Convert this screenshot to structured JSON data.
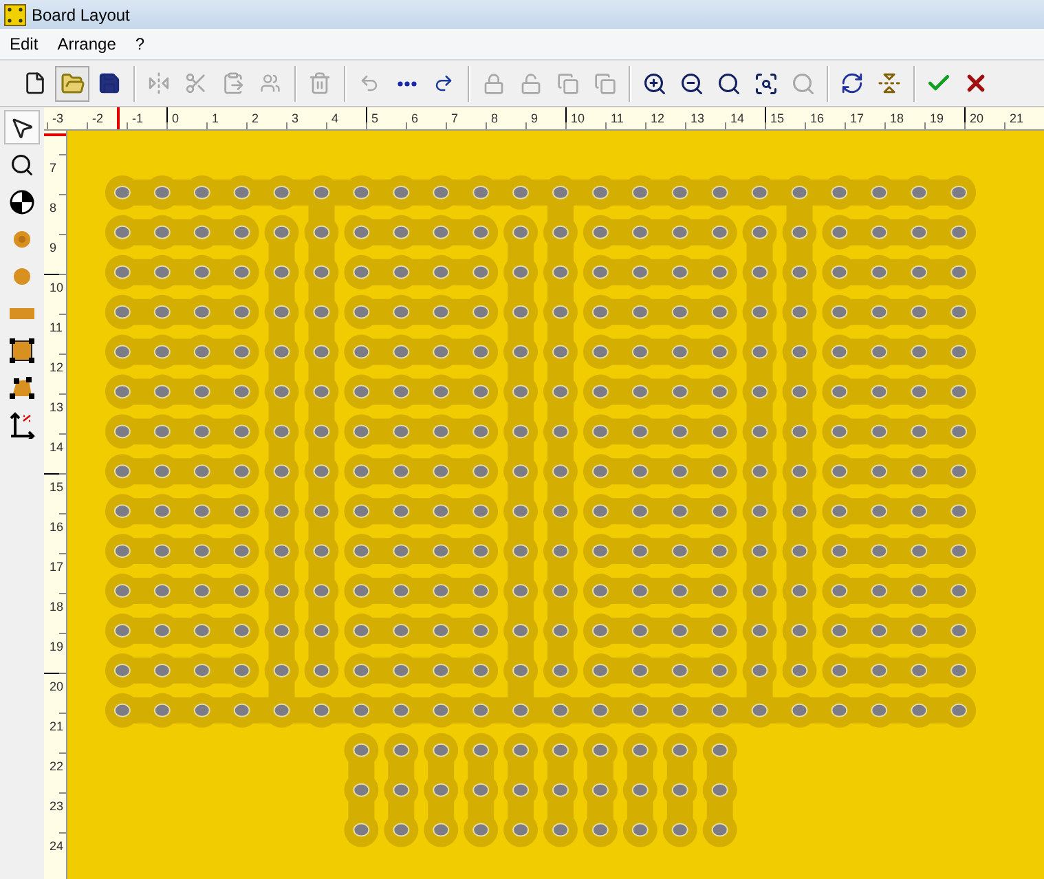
{
  "window": {
    "title": "Board Layout"
  },
  "menu": [
    {
      "label": "Edit"
    },
    {
      "label": "Arrange"
    },
    {
      "label": "?"
    }
  ],
  "toolbar": [
    [
      {
        "kind": "new",
        "disabled": false,
        "selected": false
      },
      {
        "kind": "open",
        "disabled": false,
        "selected": true
      },
      {
        "kind": "save",
        "disabled": false,
        "selected": false
      }
    ],
    [
      {
        "kind": "mirror",
        "disabled": true,
        "selected": false
      },
      {
        "kind": "cut",
        "disabled": true,
        "selected": false
      },
      {
        "kind": "paste",
        "disabled": true,
        "selected": false
      },
      {
        "kind": "group",
        "disabled": true,
        "selected": false
      }
    ],
    [
      {
        "kind": "delete",
        "disabled": true,
        "selected": false
      }
    ],
    [
      {
        "kind": "undo",
        "disabled": true,
        "selected": false
      },
      {
        "kind": "dots",
        "disabled": false,
        "selected": false
      },
      {
        "kind": "redo",
        "disabled": false,
        "selected": false
      }
    ],
    [
      {
        "kind": "lock",
        "disabled": true,
        "selected": false
      },
      {
        "kind": "unlock",
        "disabled": true,
        "selected": false
      },
      {
        "kind": "front",
        "disabled": true,
        "selected": false
      },
      {
        "kind": "back",
        "disabled": true,
        "selected": false
      }
    ],
    [
      {
        "kind": "zoomin",
        "disabled": false,
        "selected": false
      },
      {
        "kind": "zoomout",
        "disabled": false,
        "selected": false
      },
      {
        "kind": "zoomfit",
        "disabled": false,
        "selected": false
      },
      {
        "kind": "zoomarea",
        "disabled": false,
        "selected": false
      },
      {
        "kind": "zoomprev",
        "disabled": true,
        "selected": false
      }
    ],
    [
      {
        "kind": "rotate",
        "disabled": false,
        "selected": false
      },
      {
        "kind": "flip",
        "disabled": false,
        "selected": false
      }
    ],
    [
      {
        "kind": "ok",
        "disabled": false,
        "selected": false
      },
      {
        "kind": "cancel",
        "disabled": false,
        "selected": false
      }
    ]
  ],
  "tools": [
    {
      "kind": "select",
      "selected": true
    },
    {
      "kind": "zoom",
      "selected": false
    },
    {
      "kind": "testpoint",
      "selected": false
    },
    {
      "kind": "ringpad",
      "selected": false
    },
    {
      "kind": "pad",
      "selected": false
    },
    {
      "kind": "strip",
      "selected": false
    },
    {
      "kind": "rect",
      "selected": false
    },
    {
      "kind": "poly",
      "selected": false
    },
    {
      "kind": "dimension",
      "selected": false
    }
  ],
  "ruler_top": [
    {
      "label": "-3",
      "major": false
    },
    {
      "label": "-2",
      "major": false
    },
    {
      "label": "-1",
      "major": false
    },
    {
      "label": "0",
      "major": true
    },
    {
      "label": "1",
      "major": false
    },
    {
      "label": "2",
      "major": false
    },
    {
      "label": "3",
      "major": false
    },
    {
      "label": "4",
      "major": false
    },
    {
      "label": "5",
      "major": true
    },
    {
      "label": "6",
      "major": false
    },
    {
      "label": "7",
      "major": false
    },
    {
      "label": "8",
      "major": false
    },
    {
      "label": "9",
      "major": false
    },
    {
      "label": "10",
      "major": true
    },
    {
      "label": "11",
      "major": false
    },
    {
      "label": "12",
      "major": false
    },
    {
      "label": "13",
      "major": false
    },
    {
      "label": "14",
      "major": false
    },
    {
      "label": "15",
      "major": true
    },
    {
      "label": "16",
      "major": false
    },
    {
      "label": "17",
      "major": false
    },
    {
      "label": "18",
      "major": false
    },
    {
      "label": "19",
      "major": false
    },
    {
      "label": "20",
      "major": true
    },
    {
      "label": "21",
      "major": false
    }
  ],
  "ruler_left": [
    {
      "label": "7",
      "major": false
    },
    {
      "label": "8",
      "major": false
    },
    {
      "label": "9",
      "major": false
    },
    {
      "label": "10",
      "major": true
    },
    {
      "label": "11",
      "major": false
    },
    {
      "label": "12",
      "major": false
    },
    {
      "label": "13",
      "major": false
    },
    {
      "label": "14",
      "major": false
    },
    {
      "label": "15",
      "major": true
    },
    {
      "label": "16",
      "major": false
    },
    {
      "label": "17",
      "major": false
    },
    {
      "label": "18",
      "major": false
    },
    {
      "label": "19",
      "major": false
    },
    {
      "label": "20",
      "major": true
    },
    {
      "label": "21",
      "major": false
    },
    {
      "label": "22",
      "major": false
    },
    {
      "label": "23",
      "major": false
    },
    {
      "label": "24",
      "major": false
    }
  ]
}
